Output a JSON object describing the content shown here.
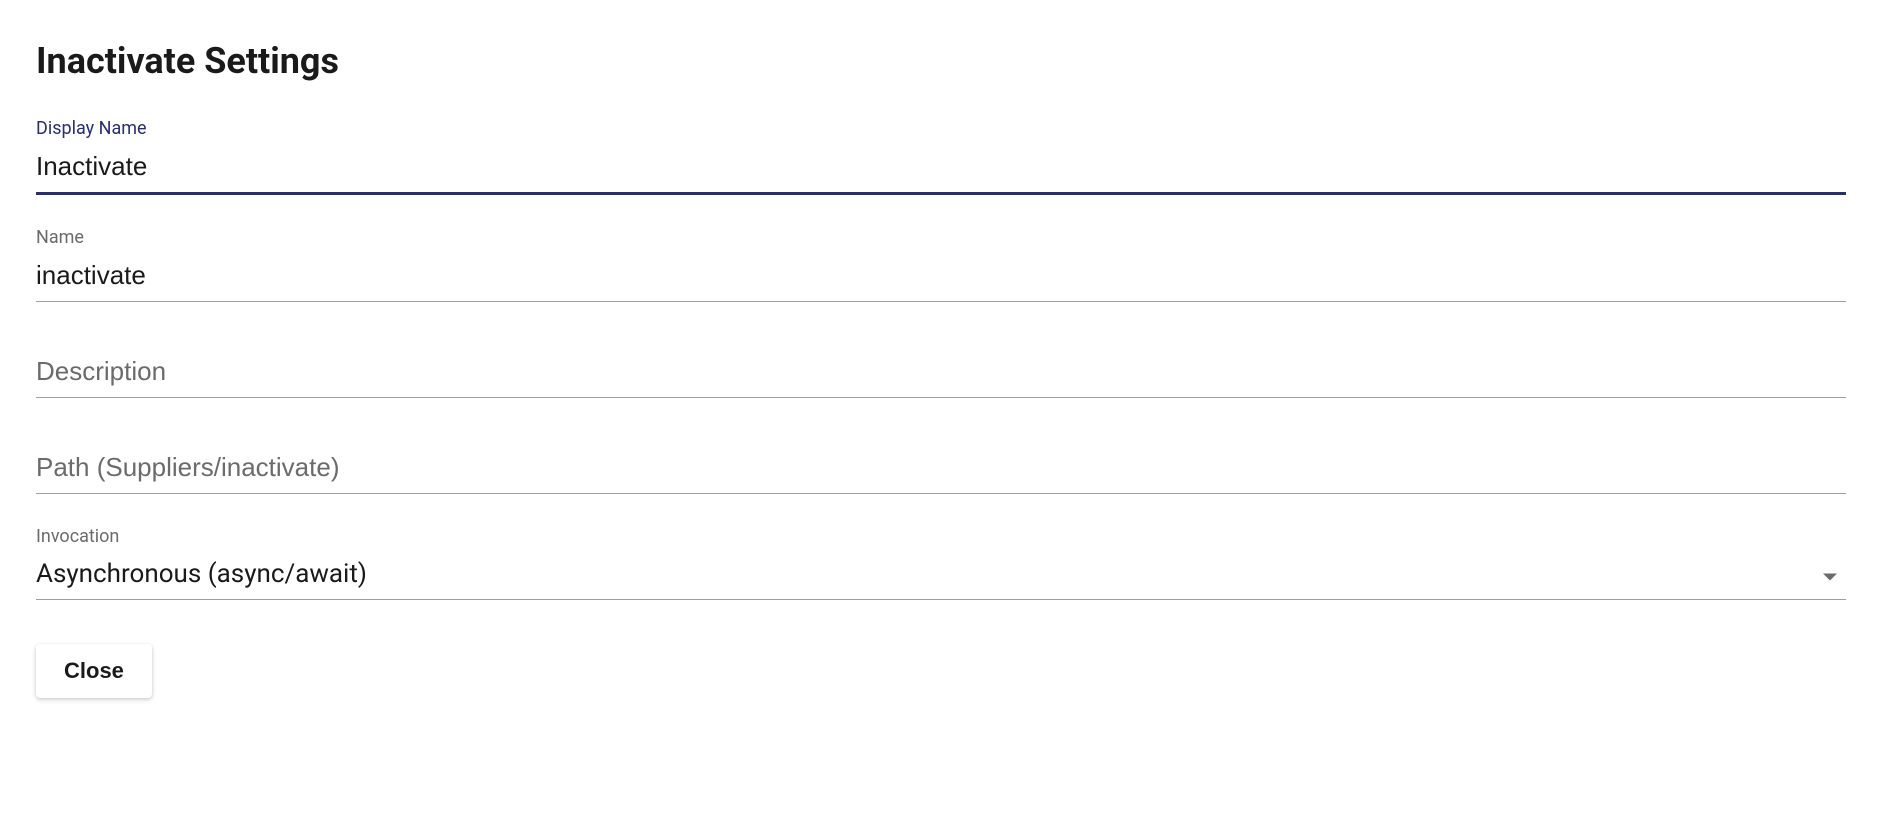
{
  "title": "Inactivate Settings",
  "fields": {
    "displayName": {
      "label": "Display Name",
      "value": "Inactivate"
    },
    "name": {
      "label": "Name",
      "value": "inactivate"
    },
    "description": {
      "placeholder": "Description",
      "value": ""
    },
    "path": {
      "placeholder": "Path (Suppliers/inactivate)",
      "value": ""
    },
    "invocation": {
      "label": "Invocation",
      "value": "Asynchronous (async/await)"
    }
  },
  "buttons": {
    "close": "Close"
  }
}
